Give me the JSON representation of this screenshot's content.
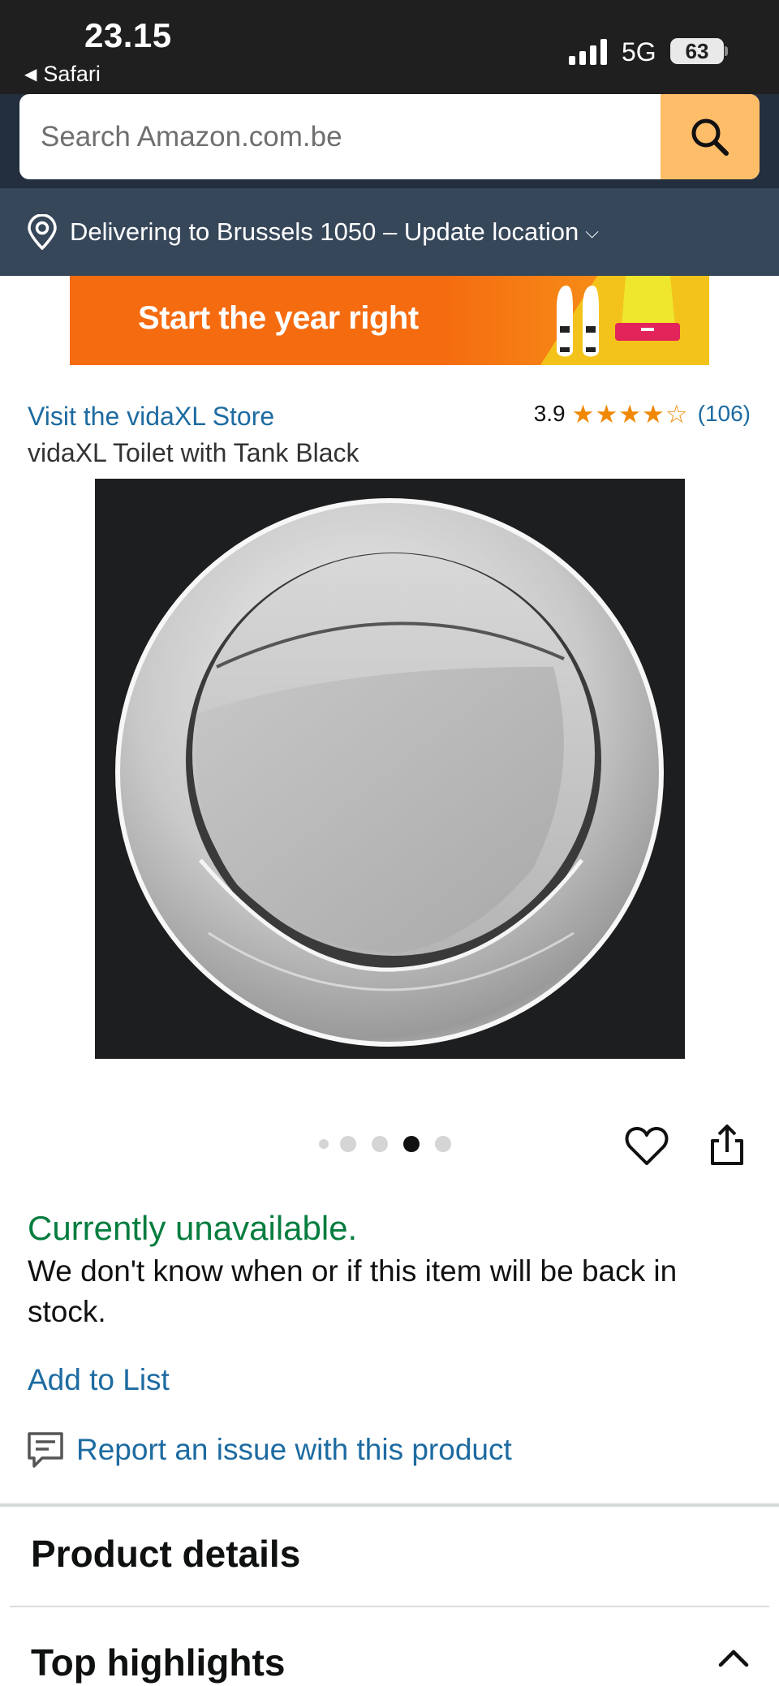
{
  "status_bar": {
    "time": "23.15",
    "back_app": "Safari",
    "network": "5G",
    "battery": "63"
  },
  "search": {
    "placeholder": "Search Amazon.com.be"
  },
  "delivery": {
    "text": "Delivering to Brussels 1050 – Update location"
  },
  "banner": {
    "headline": "Start the year right"
  },
  "product": {
    "store_link": "Visit the vidaXL Store",
    "rating_value": "3.9",
    "rating_count": "(106)",
    "stars_filled": 4,
    "stars_total": 5,
    "title": "vidaXL Toilet with Tank Black"
  },
  "carousel": {
    "total": 5,
    "active_index": 3
  },
  "availability": {
    "status": "Currently unavailable.",
    "message": "We don't know when or if this item will be back in stock."
  },
  "actions": {
    "add_to_list": "Add to List",
    "report_issue": "Report an issue with this product"
  },
  "sections": {
    "product_details": "Product details",
    "top_highlights": "Top highlights"
  },
  "colors": {
    "header_dark": "#232f3e",
    "delivery_bar": "#37475a",
    "search_button": "#febd69",
    "link": "#1d6ba1",
    "availability": "#067d3f",
    "star": "#f08804"
  }
}
